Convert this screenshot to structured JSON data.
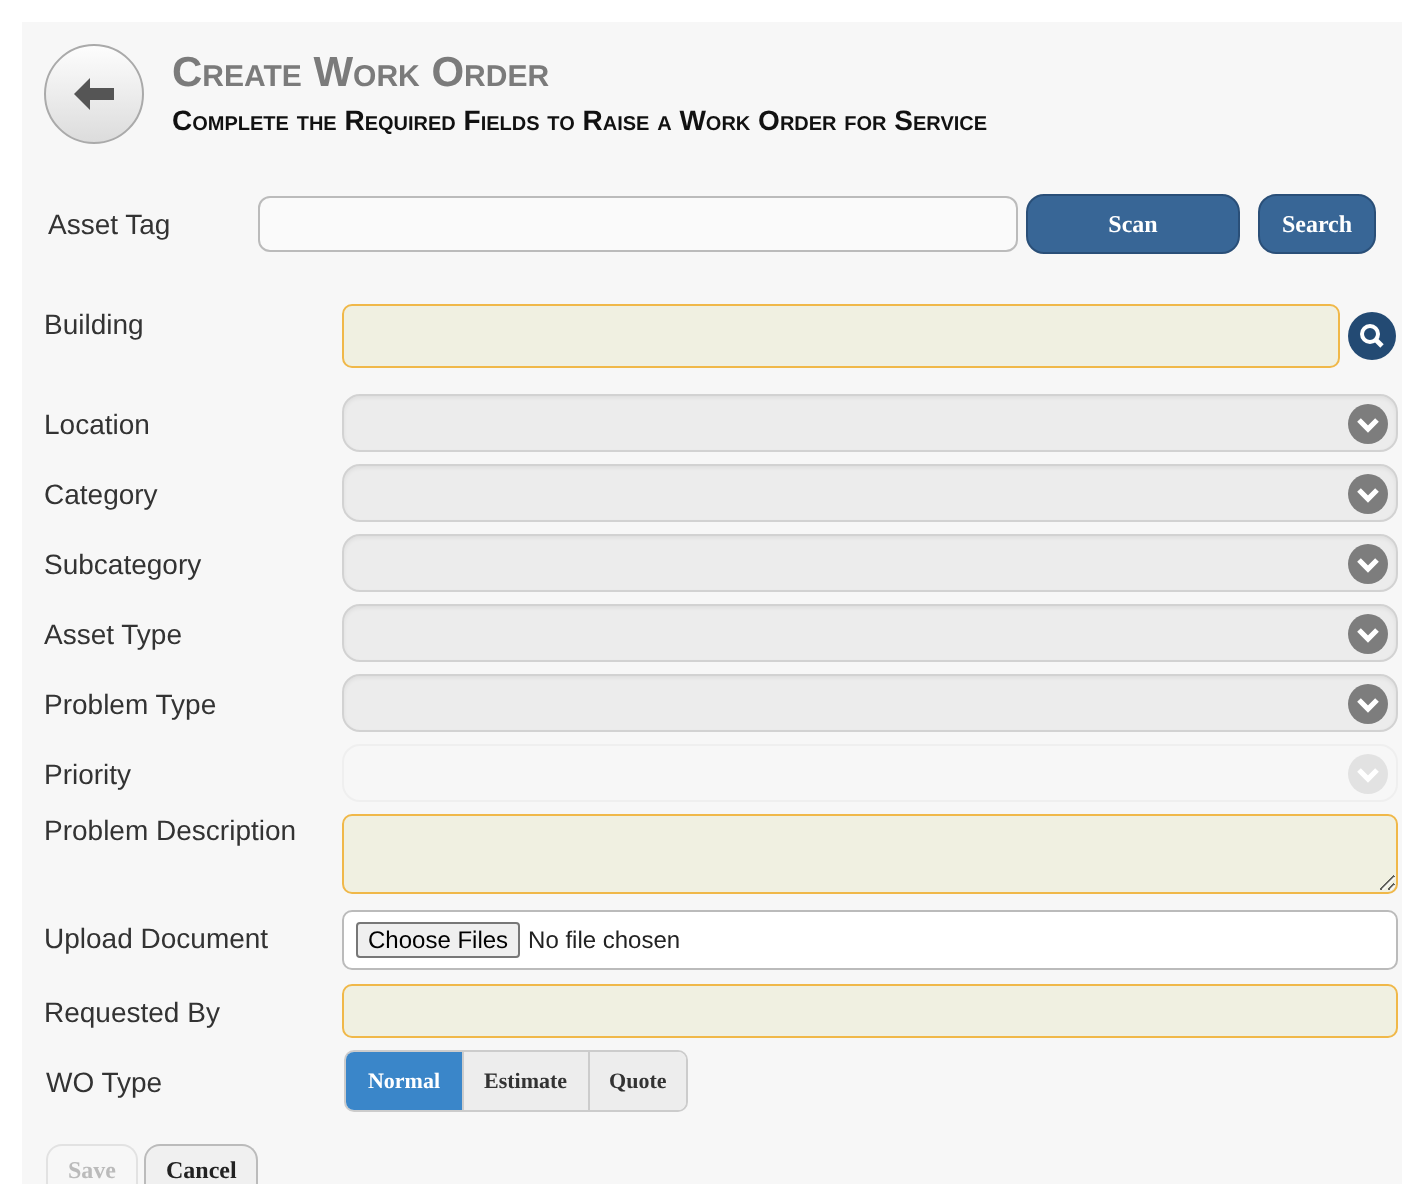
{
  "header": {
    "title": "Create Work Order",
    "subtitle": "Complete the Required Fields to Raise a Work Order for Service"
  },
  "asset_tag": {
    "label": "Asset Tag",
    "buttons": [
      "Scan",
      "Search"
    ]
  },
  "fields": [
    {
      "label": "Building",
      "kind": "lookup",
      "required": true
    },
    {
      "label": "Location",
      "kind": "select",
      "disabled": false
    },
    {
      "label": "Category",
      "kind": "select",
      "disabled": false
    },
    {
      "label": "Subcategory",
      "kind": "select",
      "disabled": false
    },
    {
      "label": "Asset Type",
      "kind": "select",
      "disabled": false
    },
    {
      "label": "Problem Type",
      "kind": "select",
      "disabled": false
    },
    {
      "label": "Priority",
      "kind": "select",
      "disabled": true
    },
    {
      "label": "Problem Description",
      "kind": "textarea",
      "required": true
    },
    {
      "label": "Upload Document",
      "kind": "file",
      "button": "Choose Files",
      "status": "No file chosen"
    },
    {
      "label": "Requested By",
      "kind": "text",
      "required": true
    },
    {
      "label": "WO Type",
      "kind": "segmented",
      "options": [
        {
          "label": "Normal",
          "selected": true
        },
        {
          "label": "Estimate",
          "selected": false
        },
        {
          "label": "Quote",
          "selected": false
        }
      ]
    }
  ],
  "actions": [
    {
      "label": "Save",
      "disabled": true
    },
    {
      "label": "Cancel",
      "disabled": false
    }
  ]
}
